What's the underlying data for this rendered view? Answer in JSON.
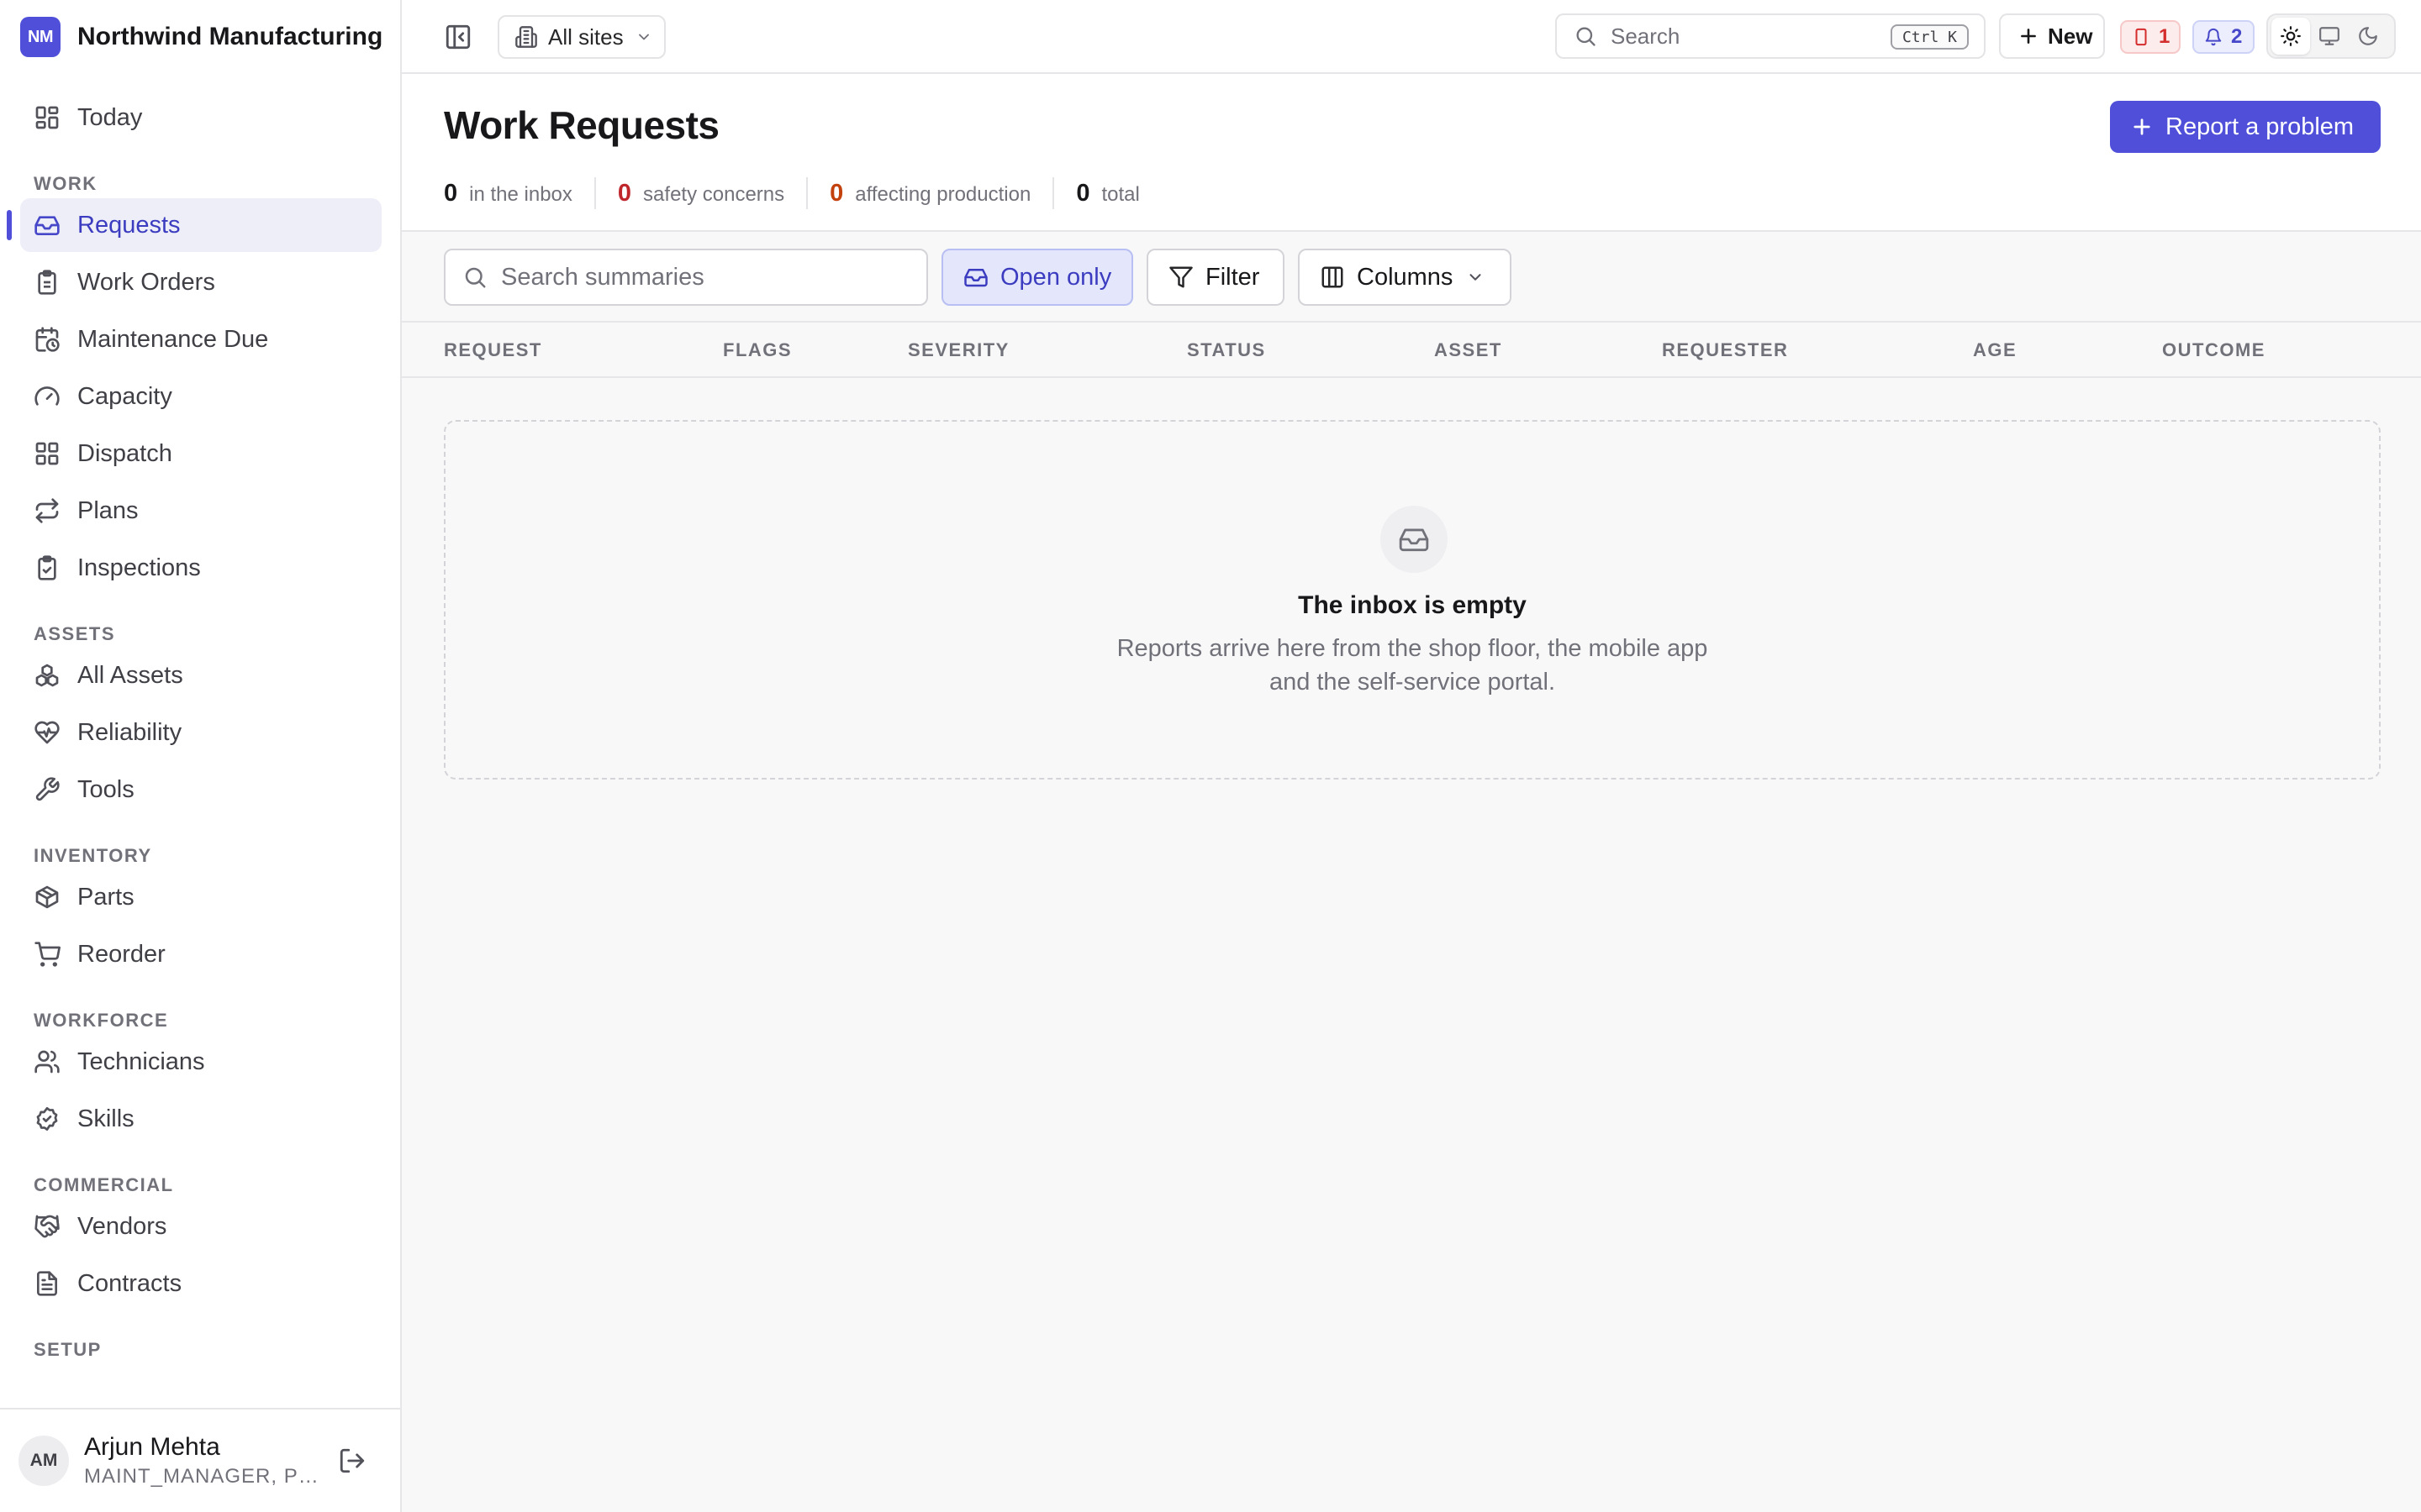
{
  "brand": {
    "initials": "NM",
    "name": "Northwind Manufacturing"
  },
  "nav": {
    "top": [
      {
        "label": "Today",
        "icon": "dashboard-icon"
      }
    ],
    "sections": {
      "work": {
        "label": "WORK",
        "items": [
          {
            "label": "Requests",
            "icon": "inbox-icon",
            "active": true
          },
          {
            "label": "Work Orders",
            "icon": "clipboard-icon"
          },
          {
            "label": "Maintenance Due",
            "icon": "calendar-clock-icon"
          },
          {
            "label": "Capacity",
            "icon": "gauge-icon"
          },
          {
            "label": "Dispatch",
            "icon": "grid-icon"
          },
          {
            "label": "Plans",
            "icon": "repeat-icon"
          },
          {
            "label": "Inspections",
            "icon": "clipboard-check-icon"
          }
        ]
      },
      "assets": {
        "label": "ASSETS",
        "items": [
          {
            "label": "All Assets",
            "icon": "boxes-icon"
          },
          {
            "label": "Reliability",
            "icon": "heart-pulse-icon"
          },
          {
            "label": "Tools",
            "icon": "wrench-icon"
          }
        ]
      },
      "inventory": {
        "label": "INVENTORY",
        "items": [
          {
            "label": "Parts",
            "icon": "package-icon"
          },
          {
            "label": "Reorder",
            "icon": "cart-icon"
          }
        ]
      },
      "workforce": {
        "label": "WORKFORCE",
        "items": [
          {
            "label": "Technicians",
            "icon": "users-icon"
          },
          {
            "label": "Skills",
            "icon": "badge-check-icon"
          }
        ]
      },
      "commercial": {
        "label": "COMMERCIAL",
        "items": [
          {
            "label": "Vendors",
            "icon": "handshake-icon"
          },
          {
            "label": "Contracts",
            "icon": "file-text-icon"
          }
        ]
      },
      "setup": {
        "label": "SETUP"
      }
    }
  },
  "user": {
    "initials": "AM",
    "name": "Arjun Mehta",
    "role": "MAINT_MANAGER, PL..."
  },
  "topbar": {
    "site_label": "All sites",
    "search_label": "Search",
    "search_shortcut": "Ctrl K",
    "new_label": "New",
    "alert_count": "1",
    "notification_count": "2"
  },
  "page": {
    "title": "Work Requests",
    "primary_action": "Report a problem",
    "stats": [
      {
        "value": "0",
        "label": "in the inbox"
      },
      {
        "value": "0",
        "label": "safety concerns"
      },
      {
        "value": "0",
        "label": "affecting production"
      },
      {
        "value": "0",
        "label": "total"
      }
    ]
  },
  "toolbar": {
    "search_placeholder": "Search summaries",
    "open_only_label": "Open only",
    "filter_label": "Filter",
    "columns_label": "Columns"
  },
  "table": {
    "columns": [
      "REQUEST",
      "FLAGS",
      "SEVERITY",
      "STATUS",
      "ASSET",
      "REQUESTER",
      "AGE",
      "OUTCOME"
    ]
  },
  "empty_state": {
    "title": "The inbox is empty",
    "description_line1": "Reports arrive here from the shop floor, the mobile app",
    "description_line2": "and the self-service portal."
  },
  "colors": {
    "accent": "#4f4fd9",
    "safety": "#c0272d",
    "production": "#c2410c"
  }
}
